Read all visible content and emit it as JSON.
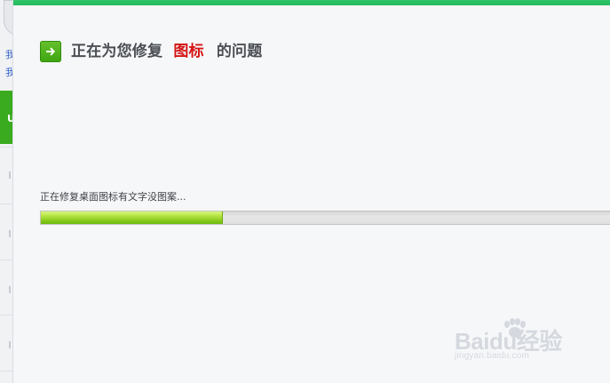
{
  "background": {
    "left_links": [
      "我",
      "我"
    ],
    "green_letter": "U"
  },
  "dialog": {
    "title_prefix": "正在为您修复",
    "title_highlight": "图标",
    "title_suffix": "的问题",
    "status_text": "正在修复桌面图标有文字没图案...",
    "progress_fraction": 0.32,
    "icon": "arrow-right-icon"
  },
  "watermark": {
    "main": "Baidu经验",
    "sub": "jingyan.baidu.com"
  },
  "colors": {
    "top_bar": "#23b95a",
    "highlight": "#d51414",
    "progress_fill": "#88cb1b"
  }
}
